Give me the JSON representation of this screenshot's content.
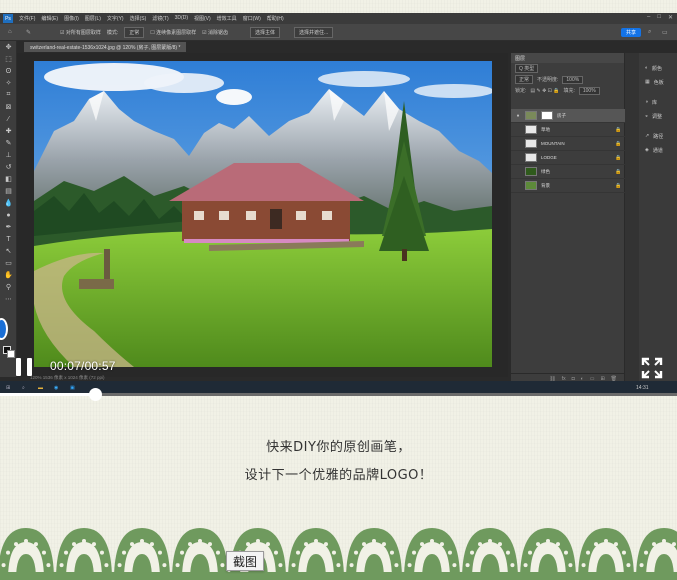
{
  "photoshop": {
    "menu": [
      "文件(F)",
      "编辑(E)",
      "图像(I)",
      "图层(L)",
      "文字(Y)",
      "选择(S)",
      "滤镜(T)",
      "3D(D)",
      "视图(V)",
      "增效工具",
      "窗口(W)",
      "帮助(H)"
    ],
    "logo": "Ps",
    "options": {
      "auto_select": "☑ 对所有图层取样",
      "mode_label": "模式:",
      "mode_value": "正常",
      "edge": "☐ 连续像素图层取样",
      "smooth": "☑ 消除锯齿",
      "select_subject": "选择主体",
      "select_refine": "选择并遮住...",
      "share": "共享"
    },
    "doc_tab": "switzerland-real-estate-1536x1024.jpg @ 120% (房子, 图层蒙版/8) *",
    "status": "120%  1536 像素 x 1024 像素 (72 ppi)",
    "layers_panel": {
      "tab": "图层",
      "kind_filter": "Q 类型",
      "blend_mode": "正常",
      "opacity_label": "不透明度:",
      "opacity_value": "100%",
      "lock_label": "锁定:",
      "fill_label": "填充:",
      "fill_value": "100%"
    },
    "layers": [
      {
        "name": "房子",
        "thumb": "#7a8a5a",
        "visible": "●"
      },
      {
        "name": "草地",
        "thumb": "#e8e8e8",
        "visible": ""
      },
      {
        "name": "MOUNTAIN",
        "thumb": "#e8e8e8",
        "visible": ""
      },
      {
        "name": "LODGE",
        "thumb": "#e8e8e8",
        "visible": ""
      },
      {
        "name": "绿色",
        "thumb": "#2f5a1c",
        "visible": ""
      },
      {
        "name": "背景",
        "thumb": "#5d8a3a",
        "visible": ""
      }
    ],
    "right_column": [
      {
        "icon": "◐",
        "label": "颜色"
      },
      {
        "icon": "▦",
        "label": "色板"
      },
      {
        "icon": "◑",
        "label": "库"
      },
      {
        "icon": "◒",
        "label": "调整"
      },
      {
        "icon": "↗",
        "label": "路径"
      },
      {
        "icon": "◈",
        "label": "通道"
      }
    ],
    "taskbar_time": "14:31"
  },
  "video": {
    "timecode": "00:07/00:57",
    "progress": 0.14
  },
  "captions": {
    "line1": "快来DIY你的原创画笔，",
    "line2": "设计下一个优雅的品牌LOGO！"
  },
  "screenshot_button": "截图",
  "colors": {
    "page_bg": "#f1f1e6",
    "lace": "#6f9a5e",
    "ps_dark": "#3b3b3b",
    "accent": "#1473e6"
  }
}
